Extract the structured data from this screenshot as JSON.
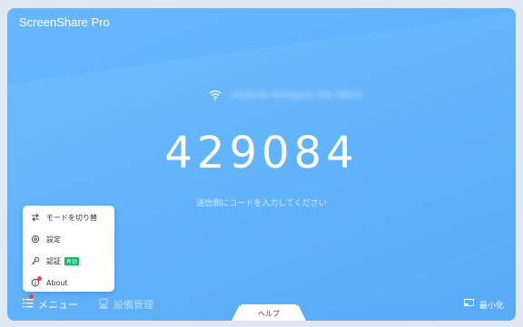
{
  "app": {
    "title": "ScreenShare Pro"
  },
  "network": {
    "ssid": "mobile-hotspot-5G-0821"
  },
  "main": {
    "code": "429084",
    "hint": "送信側にコードを入力してください"
  },
  "menu_popup": {
    "items": [
      {
        "label": "モードを切り替",
        "icon": "swap-icon"
      },
      {
        "label": "設定",
        "icon": "settings-icon"
      },
      {
        "label": "認証",
        "icon": "key-icon",
        "badge": "有効"
      },
      {
        "label": "About",
        "icon": "info-icon"
      }
    ]
  },
  "bottom_bar": {
    "menu_label": "メニュー",
    "device_label": "設備管理",
    "help_label": "ヘルプ",
    "minimize_label": "最小化"
  },
  "colors": {
    "background_blue": "#5db1fb",
    "badge_green": "#17b26a",
    "notification_red": "#f0413d"
  }
}
